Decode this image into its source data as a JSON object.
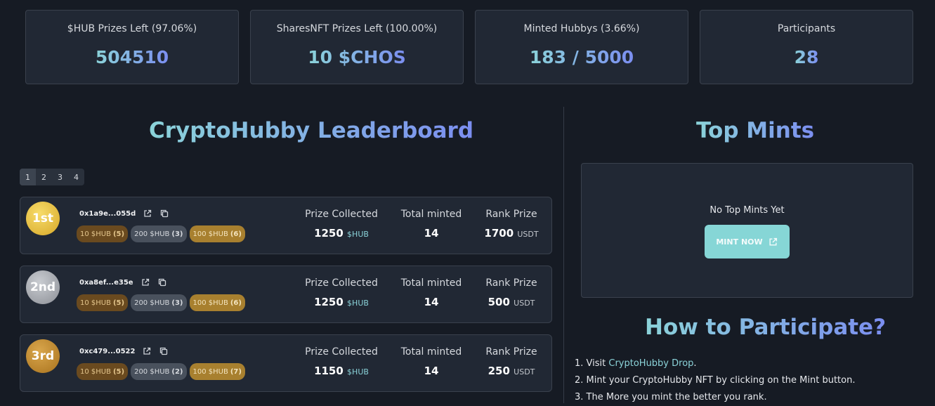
{
  "stats": [
    {
      "label": "$HUB Prizes Left (97.06%)",
      "value": "504510"
    },
    {
      "label": "SharesNFT Prizes Left (100.00%)",
      "value": "10 $CHOS"
    },
    {
      "label": "Minted Hubbys (3.66%)",
      "value": "183 / 5000"
    },
    {
      "label": "Participants",
      "value": "28"
    }
  ],
  "leaderboard": {
    "title": "CryptoHubby Leaderboard",
    "pages": [
      "1",
      "2",
      "3",
      "4"
    ],
    "headers": {
      "prize_collected": "Prize Collected",
      "total_minted": "Total minted",
      "rank_prize": "Rank Prize"
    },
    "rows": [
      {
        "rank": "1st",
        "address": "0x1a9e...055d",
        "badges": [
          {
            "text": "10 $HUB",
            "count": "(5)"
          },
          {
            "text": "200 $HUB",
            "count": "(3)"
          },
          {
            "text": "100 $HUB",
            "count": "(6)"
          }
        ],
        "prize_collected": "1250",
        "prize_unit": "$HUB",
        "total_minted": "14",
        "rank_prize": "1700",
        "rank_unit": "USDT"
      },
      {
        "rank": "2nd",
        "address": "0xa8ef...e35e",
        "badges": [
          {
            "text": "10 $HUB",
            "count": "(5)"
          },
          {
            "text": "200 $HUB",
            "count": "(3)"
          },
          {
            "text": "100 $HUB",
            "count": "(6)"
          }
        ],
        "prize_collected": "1250",
        "prize_unit": "$HUB",
        "total_minted": "14",
        "rank_prize": "500",
        "rank_unit": "USDT"
      },
      {
        "rank": "3rd",
        "address": "0xc479...0522",
        "badges": [
          {
            "text": "10 $HUB",
            "count": "(5)"
          },
          {
            "text": "200 $HUB",
            "count": "(2)"
          },
          {
            "text": "100 $HUB",
            "count": "(7)"
          }
        ],
        "prize_collected": "1150",
        "prize_unit": "$HUB",
        "total_minted": "14",
        "rank_prize": "250",
        "rank_unit": "USDT"
      }
    ]
  },
  "top_mints": {
    "title": "Top Mints",
    "empty_text": "No Top Mints Yet",
    "button_label": "MINT NOW"
  },
  "participate": {
    "title": "How to Participate?",
    "step1_prefix": "1. Visit ",
    "step1_link": "CryptoHubby Drop",
    "step1_suffix": ".",
    "step2": "2. Mint your CryptoHubby NFT by clicking on the Mint button.",
    "step3": "3. The More you mint the better you rank."
  },
  "colors": {
    "accent_start": "#8bd3d9",
    "accent_end": "#7b8ef0",
    "mint_button": "#86d6d6"
  }
}
